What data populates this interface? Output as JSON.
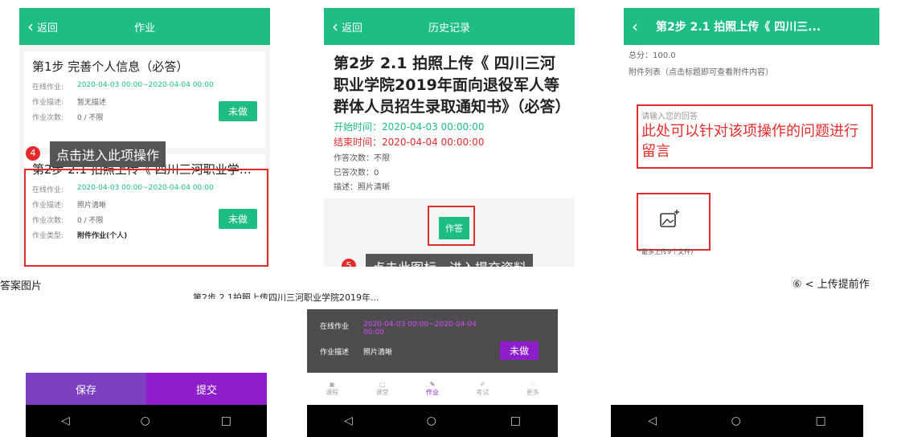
{
  "p1": {
    "back": "返回",
    "title": "作业",
    "card1": {
      "title": "第1步  完善个人信息（必答）",
      "online_k": "在线作业:",
      "online_v": "2020-04-03 00:00~2020-04-04 00:00",
      "desc_k": "作业描述:",
      "desc_v": "暂无描述",
      "count_k": "作业次数:",
      "count_v": "0 / 不限",
      "status": "未做"
    },
    "tooltip": "点击进入此项操作",
    "badge": "4",
    "card2": {
      "title": "第2步  2.1 拍照上传《 四川三河职业学院...",
      "online_k": "在线作业:",
      "online_v": "2020-04-03 00:00~2020-04-04 00:00",
      "desc_k": "作业描述:",
      "desc_v": "照片清晰",
      "count_k": "作业次数:",
      "count_v": "0 / 不限",
      "type_k": "作业类型:",
      "type_v": "附件作业(个人)",
      "status": "未做"
    }
  },
  "p2": {
    "back": "返回",
    "title": "历史记录",
    "big_title": "第2步  2.1 拍照上传《 四川三河职业学院2019年面向退役军人等群体人员招生录取通知书》（必答）",
    "start": "开始时间：2020-04-03 00:00:00",
    "end": "结束时间：2020-04-04 00:00:00",
    "answer_count": "作答次数：不限",
    "answered": "已答次数：0",
    "desc": "描述：照片清晰",
    "btn": "作答",
    "badge": "5",
    "tooltip": "点击此图标，进入提交资料"
  },
  "p3": {
    "back": "‹",
    "title": "第2步  2.1 拍照上传《 四川三...",
    "total": "总分：100.0",
    "attach": "附件列表（点击标题即可查看附件内容）",
    "placeholder": "请输入您的回答",
    "note": "此处可以针对该项操作的问题进行留言",
    "upload_hint": "*最多上传9个文件)"
  },
  "bottom": {
    "strip1": "答案图片",
    "strip2": "第2步  2.1拍照上传四川三河职业学院2019年...",
    "strip3": "⑥ < 上传提前作",
    "save": "保存",
    "submit": "提交",
    "b2_online_k": "在线作业",
    "b2_online_v": "2020-04-03 00:00~2020-04-04 00:00",
    "b2_desc_k": "作业描述",
    "b2_desc_v": "照片清晰",
    "b2_status": "未做",
    "tabs": [
      "课程",
      "课堂",
      "作业",
      "考试",
      "更多"
    ]
  },
  "colors": {
    "green": "#1ebd83",
    "red": "#e32b2b",
    "purple": "#8e1ec9"
  }
}
